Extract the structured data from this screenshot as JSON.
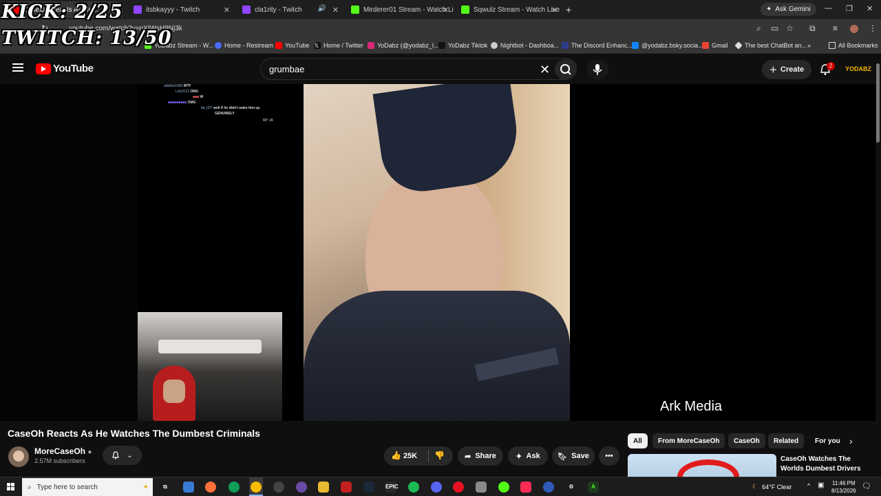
{
  "overlay": {
    "kick": "KICK: 2/25",
    "twitch": "TWITCH: 13/50"
  },
  "browser": {
    "tabs": [
      {
        "label": "CaseOh Reacts As He...",
        "color": "#ff0000",
        "active": true
      },
      {
        "label": "itsbkayyy - Twitch",
        "color": "#9146ff"
      },
      {
        "label": "cla1rity - Twitch",
        "color": "#9146ff"
      },
      {
        "label": "Mirderer01 Stream - Watch Live",
        "color": "#53fc18"
      },
      {
        "label": "Sqwulz Stream - Watch Live on",
        "color": "#53fc18"
      }
    ],
    "new_tab": "+",
    "ask_gemini": "Ask Gemini",
    "url": "youtube.com/watch?v=nXIWsH9Nj3k",
    "bookmarks": [
      "YoDabz Stream - W...",
      "Home - Restream",
      "YouTube",
      "Home / Twitter",
      "YoDabz (@yodabz_l...",
      "YoDabz Tiktok",
      "Nightbot - Dashboa...",
      "The Discord Enhanc...",
      "@yodabz.bsky.socia...",
      "Gmail",
      "The best ChatBot an..."
    ],
    "bookmarks_more": "»",
    "all_bookmarks": "All Bookmarks"
  },
  "youtube": {
    "logo_text": "YouTube",
    "search_value": "grumbae",
    "create_label": "Create",
    "notification_count": "2",
    "channel_avatar_text": "YODABZ"
  },
  "video": {
    "chat": [
      {
        "user": "adeline1906",
        "msg": "WTF"
      },
      {
        "user": "Lefy2111",
        "msg": "OMG"
      },
      {
        "user": "",
        "msg": "W"
      },
      {
        "user": "",
        "msg": "OMG"
      },
      {
        "user": "bb_027",
        "msg": "well if he didn't wake him up"
      },
      {
        "user": "",
        "msg": "GENUINELY"
      },
      {
        "user": "",
        "msg": "MY JA"
      }
    ],
    "watermark": "Ark Media",
    "title": "CaseOh Reacts As He Watches The Dumbest Criminals",
    "channel_name": "MoreCaseOh",
    "subscribers": "2.57M subscribers",
    "likes": "25K",
    "share": "Share",
    "ask": "Ask",
    "save": "Save"
  },
  "chips": [
    "All",
    "From MoreCaseOh",
    "CaseOh",
    "Related",
    "For you"
  ],
  "recommendation": {
    "title": "CaseOh Watches The Worlds Dumbest Drivers"
  },
  "taskbar": {
    "search_placeholder": "Type here to search",
    "weather": "64°F  Clear",
    "time": "11:46 PM",
    "date": "8/13/2026"
  }
}
